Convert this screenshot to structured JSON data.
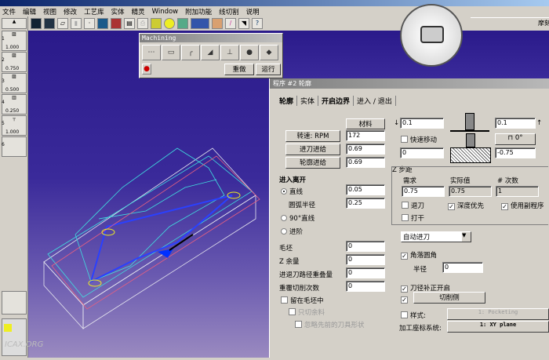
{
  "menu": [
    "文件",
    "编辑",
    "视图",
    "修改",
    "工艺库",
    "实体",
    "精灵",
    "Window",
    "附加功能",
    "线切割",
    "说明"
  ],
  "toolbar": {
    "icons": [
      "select-icon",
      "frame-icon",
      "box-icon",
      "shade-icon",
      "point-icon",
      "view-icon",
      "color-icon",
      "layer-icon",
      "print-icon",
      "solid-icon",
      "sphere-icon",
      "cylinder-icon",
      "line-icon",
      "material-icon",
      "pen-icon",
      "cursor-icon",
      "help-icon"
    ]
  },
  "tools": [
    {
      "n": "1",
      "v": "1.000"
    },
    {
      "n": "2",
      "v": "0.750"
    },
    {
      "n": "3",
      "v": "0.500"
    },
    {
      "n": "4",
      "v": "0.250"
    },
    {
      "n": "5",
      "v": "1.000"
    },
    {
      "n": "6",
      "v": ""
    }
  ],
  "machining": {
    "title": "Machining",
    "buttons": [
      "⋯",
      "▭",
      "╭",
      "◢",
      "⊥",
      "●",
      "◆"
    ],
    "reset": "重做",
    "run": "运行"
  },
  "corner_label": "摩刻",
  "dialog": {
    "title": "程序 #2 轮廓",
    "tabs": [
      "轮廓",
      "实体",
      "开启边界",
      "进入 / 退出"
    ],
    "material": "材料",
    "speed_label": "转速: RPM",
    "speed": "172",
    "plunge_label": "进刀进给",
    "plunge": "0.69",
    "feed_label": "轮廓进给",
    "feed": "0.69",
    "top_left": "0.1",
    "top_right": "0.1",
    "rapid": "快速移动",
    "depth_start": "0",
    "depth_end": "-0.75",
    "angle": "0°",
    "zstep": {
      "title": "Z 步距",
      "h_req": "需求",
      "h_act": "实际值",
      "h_count": "# 次数",
      "req": "0.75",
      "act": "0.75",
      "count": "1",
      "retract": "退刀",
      "depth_first": "深度优先",
      "use_sub": "使用副程序",
      "pierce": "打干"
    },
    "entry": {
      "title": "进入离开",
      "line": "直线",
      "arc_radius_label": "圆弧半径",
      "line_val": "0.05",
      "arc_val": "0.25",
      "line90": "90°直线",
      "ramp": "进阶"
    },
    "auto_entry": "自动进刀",
    "corner_round": "角落圆角",
    "radius_label": "半径",
    "radius": "0",
    "stock_label": "毛坯",
    "stock": "0",
    "zstock_label": "Z 余量",
    "zstock": "0",
    "overlap_label": "进退刀路径重叠量",
    "overlap": "0",
    "repeat_label": "重覆切削次数",
    "repeat": "0",
    "comp_on": "刀径补正开启",
    "cut_side": "切削侧",
    "keep_in_stock": "留在毛坯中",
    "only_stock": "只切余料",
    "ignore_prev": "忽略先前的刀具形状",
    "style_label": "样式:",
    "style_val": "1: Pocketing",
    "coord_label": "加工座标系统:",
    "coord_val": "1: XY plane"
  },
  "watermark": "ICAX.ORG"
}
